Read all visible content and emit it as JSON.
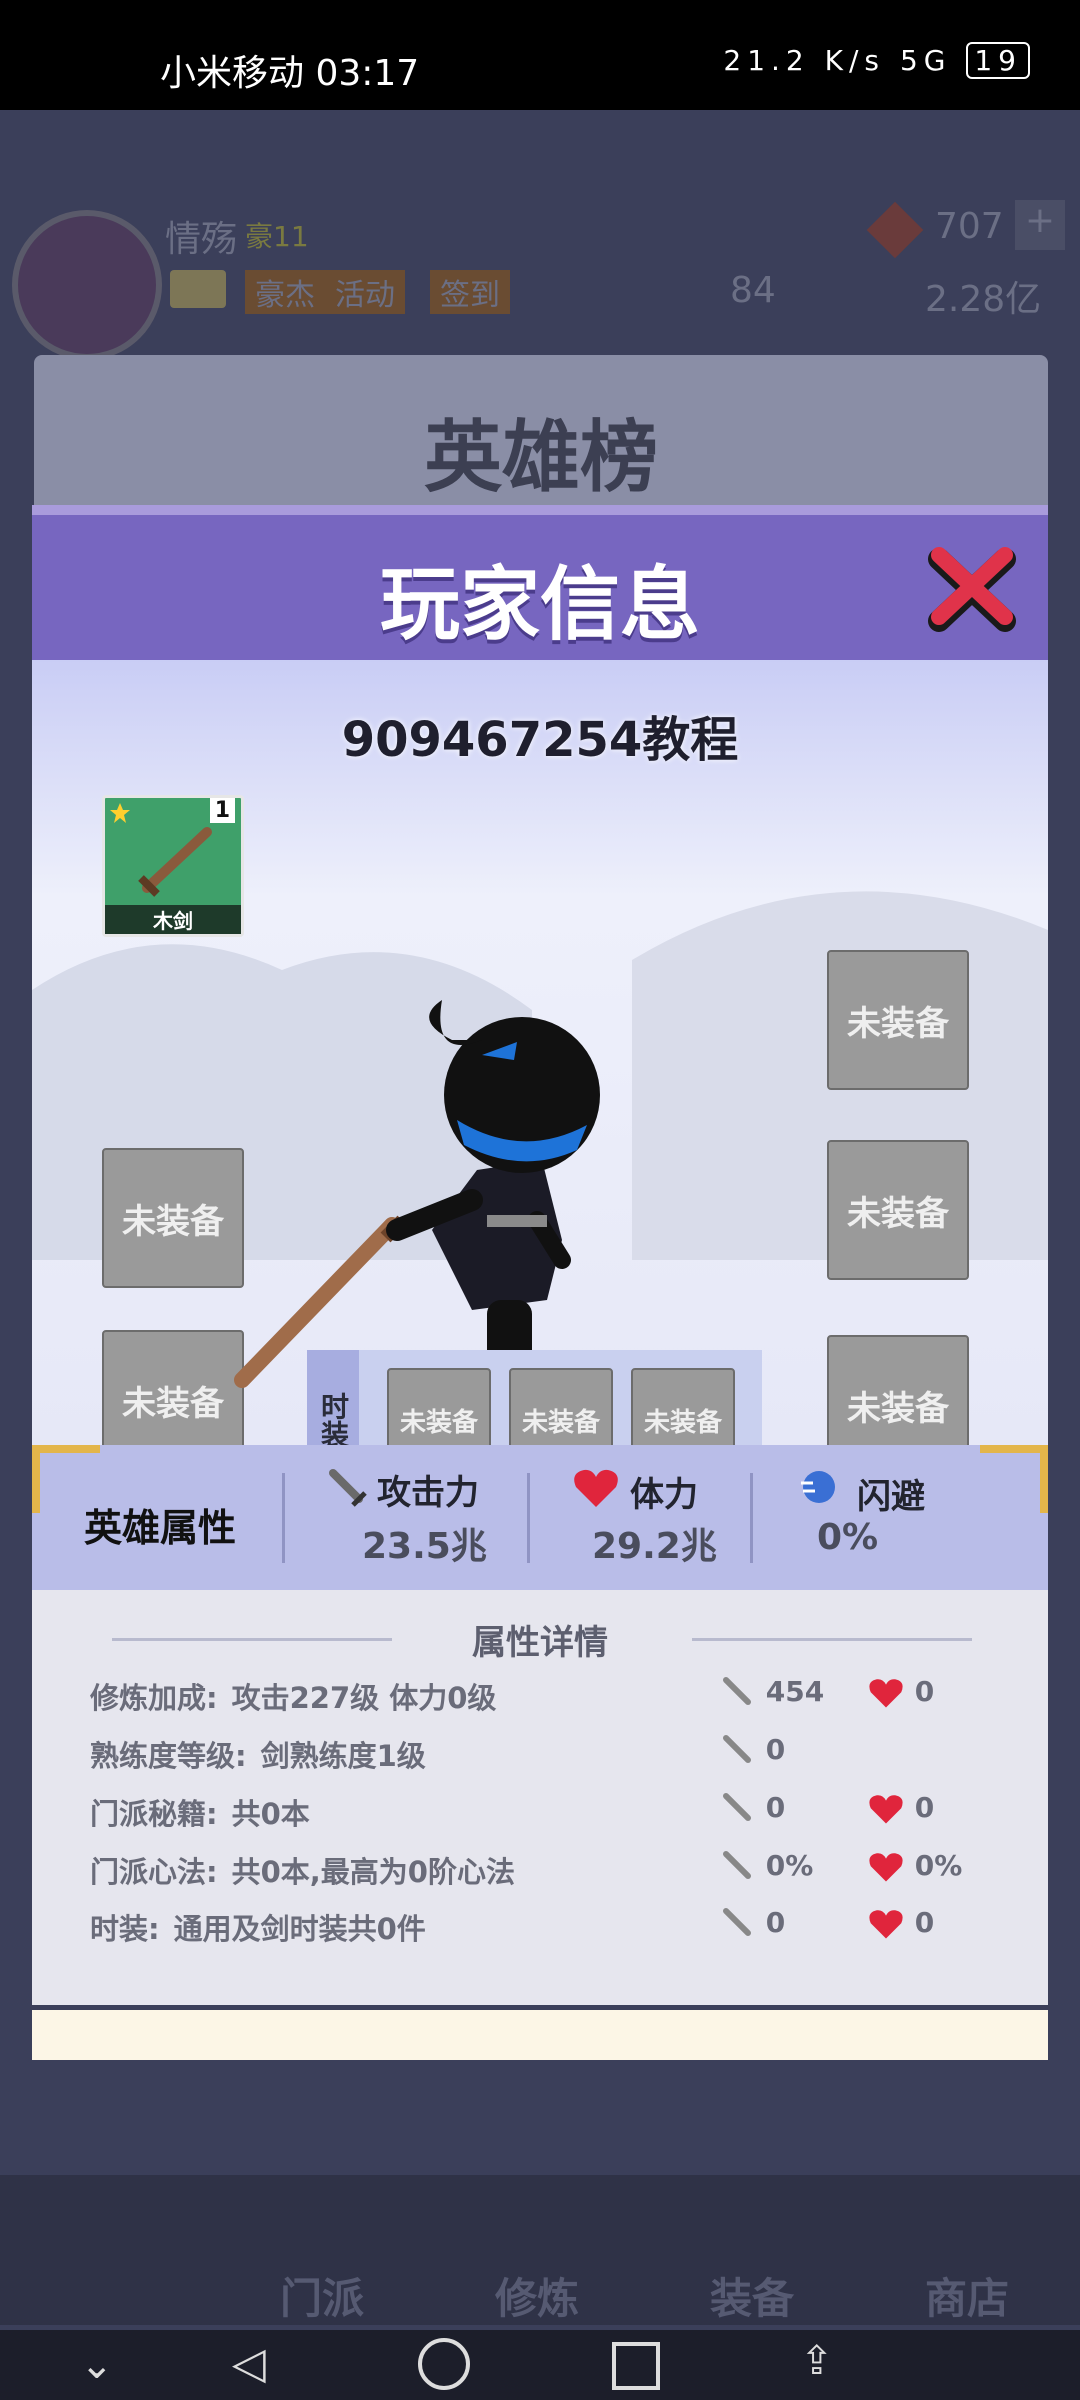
{
  "status_bar": {
    "carrier_time": "小米移动 03:17",
    "net_speed": "21.2 K/s",
    "signal": "5G",
    "battery": "19"
  },
  "hud": {
    "player_name": "情殇",
    "vip": "豪11",
    "gems": "707",
    "tokens": "84",
    "gold": "2.28亿",
    "buttons": [
      "豪杰",
      "活动",
      "签到"
    ]
  },
  "background": {
    "board_title": "英雄榜",
    "nav": [
      "门派",
      "修炼",
      "装备",
      "商店"
    ]
  },
  "modal": {
    "title": "玩家信息",
    "player_id": "909467254教程",
    "weapon": {
      "name": "木剑",
      "level": "1"
    },
    "empty_label": "未装备",
    "fashion_label": "时装",
    "stats": {
      "section_label": "英雄属性",
      "attack_label": "攻击力",
      "attack_value": "23.5兆",
      "hp_label": "体力",
      "hp_value": "29.2兆",
      "dodge_label": "闪避",
      "dodge_value": "0%"
    },
    "details": {
      "title": "属性详情",
      "rows": [
        {
          "label": "修炼加成:",
          "value": "攻击227级 体力0级",
          "atk": "454",
          "hp": "0"
        },
        {
          "label": "熟练度等级:",
          "value": "剑熟练度1级",
          "atk": "0",
          "hp": ""
        },
        {
          "label": "门派秘籍:",
          "value": "共0本",
          "atk": "0",
          "hp": "0"
        },
        {
          "label": "门派心法:",
          "value": "共0本,最高为0阶心法",
          "atk": "0%",
          "hp": "0%"
        },
        {
          "label": "时装:",
          "value": "通用及剑时装共0件",
          "atk": "0",
          "hp": "0"
        }
      ]
    }
  }
}
